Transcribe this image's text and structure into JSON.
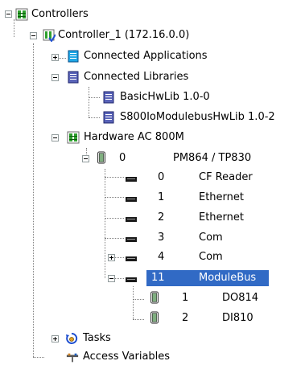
{
  "tree": {
    "root_label": "Controllers",
    "controller": "Controller_1 (172.16.0.0)",
    "connected_applications": "Connected Applications",
    "connected_libraries": "Connected Libraries",
    "libraries": [
      "BasicHwLib 1.0-0",
      "S800IoModulebusHwLib 1.0-2"
    ],
    "hardware": "Hardware  AC 800M",
    "cpu": {
      "position": "0",
      "name": "PM864 / TP830"
    },
    "units": [
      {
        "position": "0",
        "name": "CF Reader"
      },
      {
        "position": "1",
        "name": "Ethernet"
      },
      {
        "position": "2",
        "name": "Ethernet"
      },
      {
        "position": "3",
        "name": "Com"
      },
      {
        "position": "4",
        "name": "Com"
      },
      {
        "position": "11",
        "name": "ModuleBus"
      }
    ],
    "modules": [
      {
        "position": "1",
        "name": "DO814"
      },
      {
        "position": "2",
        "name": "DI810"
      }
    ],
    "tasks": "Tasks",
    "access_variables": "Access Variables"
  }
}
